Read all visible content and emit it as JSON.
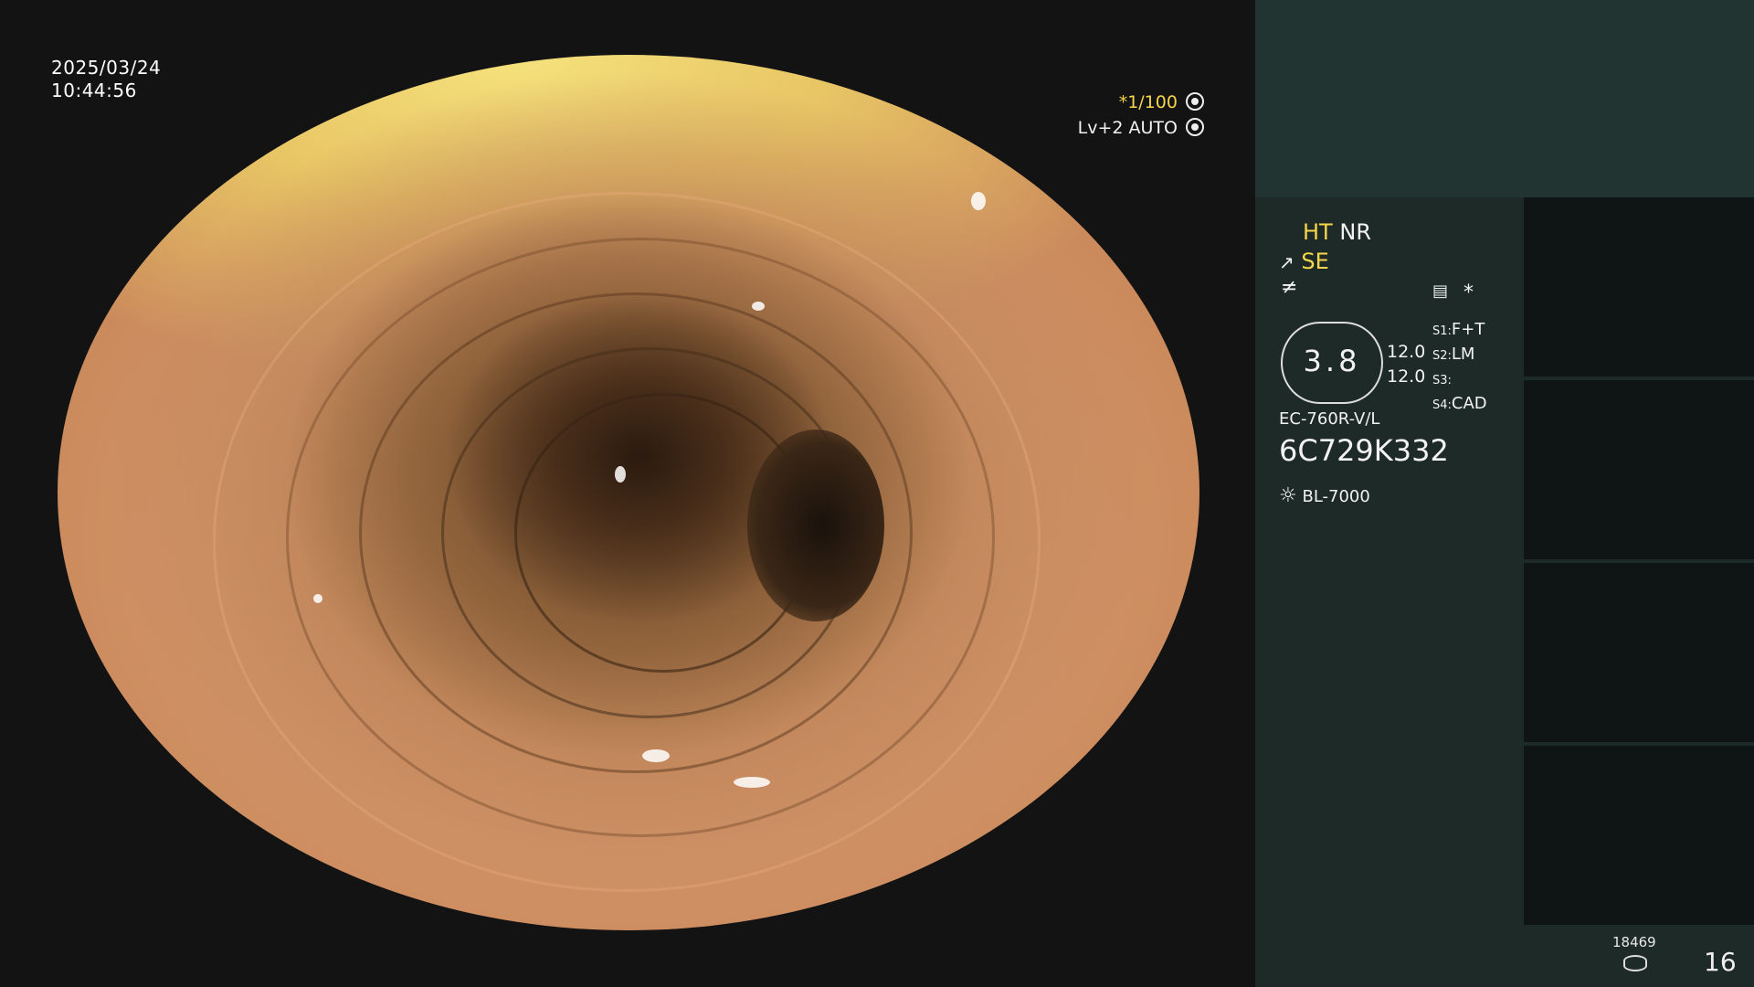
{
  "datetime": {
    "date": "2025/03/24",
    "time": "10:44:56"
  },
  "overlay": {
    "shutter": "*1/100",
    "level": "Lv+2 AUTO"
  },
  "panel": {
    "mode1_yellow": "HT",
    "mode1_white": "NR",
    "mode2": "SE",
    "gauge_value": "3.8",
    "values": [
      "12.0",
      "12.0"
    ],
    "s_labels": [
      "S1:",
      "S2:",
      "S3:",
      "S4:"
    ],
    "s_values": [
      "F+T",
      "LM",
      "",
      "CAD"
    ],
    "model": "EC-760R-V/L",
    "serial": "6C729K332",
    "light_source": "BL-7000",
    "star": "*"
  },
  "thumbnails": [
    {
      "id": "thumb-1"
    },
    {
      "id": "thumb-2"
    },
    {
      "id": "thumb-3"
    },
    {
      "id": "thumb-4"
    }
  ],
  "footer": {
    "count": "18469",
    "page": "16"
  },
  "colors": {
    "panel": "#1e2a28",
    "accent": "#f6d64a"
  }
}
